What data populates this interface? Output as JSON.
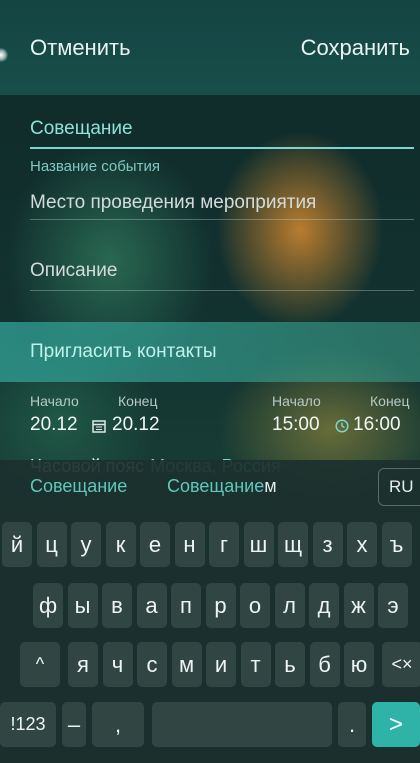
{
  "header": {
    "cancel_label": "Отменить",
    "save_label": "Сохранить"
  },
  "form": {
    "event_title_value": "Совещание",
    "event_title_hint": "Название события",
    "place_placeholder": "Место проведения мероприятия",
    "description_placeholder": "Описание",
    "invite_label": "Пригласить контакты"
  },
  "dates": {
    "start_label": "Начало",
    "end_label": "Конец",
    "start_date": "20.12",
    "end_date": "20.12",
    "start_time_label": "Начало",
    "end_time_label": "Конец",
    "start_time": "15:00",
    "end_time": "16:00",
    "calendar_icon": "calendar-icon",
    "clock_icon": "clock-icon"
  },
  "timezone": {
    "label": "Часовой пояс",
    "value": "Москва, Россия"
  },
  "keyboard": {
    "suggestions": {
      "first": "Совещание",
      "second_main": "Совещание",
      "second_tail": "м"
    },
    "language": "RU",
    "row1": [
      "й",
      "ц",
      "у",
      "к",
      "е",
      "н",
      "г",
      "ш",
      "щ",
      "з",
      "х",
      "ъ"
    ],
    "row2": [
      "ф",
      "ы",
      "в",
      "а",
      "п",
      "р",
      "о",
      "л",
      "д",
      "ж",
      "э"
    ],
    "row3": [
      "я",
      "ч",
      "с",
      "м",
      "и",
      "т",
      "ь",
      "б",
      "ю"
    ],
    "shift": "^",
    "backspace": "<×",
    "num_switch": "!123",
    "dash": "–",
    "comma": ",",
    "period": ".",
    "enter": ">"
  },
  "colors": {
    "accent": "#5fc7bd",
    "enter_key": "#2fb3a9",
    "header_bg": "#174d4a"
  }
}
